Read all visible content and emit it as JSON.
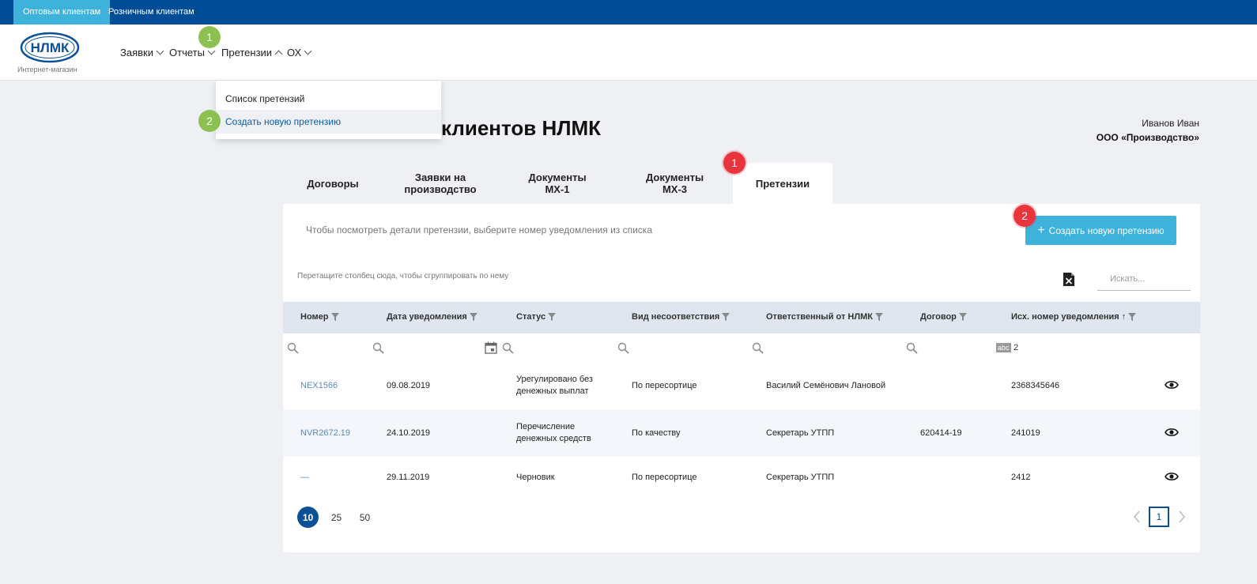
{
  "topbar": {
    "wholesale": "Оптовым клиентам",
    "retail": "Розничным клиентам"
  },
  "header": {
    "logo_text": "НЛМК",
    "logo_subtitle": "Интернет-магазин",
    "nav": {
      "orders": "Заявки",
      "reports": "Отчеты",
      "claims": "Претензии",
      "ox": "ОХ"
    }
  },
  "dropdown": {
    "list": "Список претензий",
    "create": "Создать новую претензию"
  },
  "badges": {
    "n1": "1",
    "n2": "2"
  },
  "page": {
    "title": "клиентов НЛМК",
    "user_name": "Иванов Иван",
    "user_org": "ООО «Производство»"
  },
  "tabs": {
    "contracts": "Договоры",
    "orders_line1": "Заявки на",
    "orders_line2": "производство",
    "mx1_line1": "Документы",
    "mx1_line2": "МХ-1",
    "mx3_line1": "Документы",
    "mx3_line2": "МХ-3",
    "claims": "Претензии"
  },
  "panel": {
    "hint": "Чтобы посмотреть детали претензии, выберите номер уведомления из списка",
    "create_button": "Создать новую претензию",
    "group_hint": "Перетащите столбец сюда, чтобы сгруппировать по нему",
    "search_placeholder": "Искать..."
  },
  "table": {
    "headers": {
      "number": "Номер",
      "date": "Дата уведомления",
      "status": "Статус",
      "type": "Вид несоответствия",
      "responsible": "Ответственный от НЛМК",
      "contract": "Договор",
      "outgoing": "Исх. номер уведомления",
      "sort_indicator": "↑"
    },
    "filter_value": "2",
    "rows": [
      {
        "number": "NEX1566",
        "date": "09.08.2019",
        "status_l1": "Урегулировано без",
        "status_l2": "денежных выплат",
        "type": "По пересортице",
        "responsible": "Василий Семёнович Лановой",
        "contract": "",
        "outgoing": "2368345646"
      },
      {
        "number": "NVR2672.19",
        "date": "24.10.2019",
        "status_l1": "Перечисление",
        "status_l2": "денежных средств",
        "type": "По качеству",
        "responsible": "Секретарь УТПП",
        "contract": "620414-19",
        "outgoing": "241019"
      },
      {
        "number": "—",
        "date": "29.11.2019",
        "status_l1": "Черновик",
        "status_l2": "",
        "type": "По пересортице",
        "responsible": "Секретарь УТПП",
        "contract": "",
        "outgoing": "2412"
      }
    ]
  },
  "pager": {
    "size_10": "10",
    "size_25": "25",
    "size_50": "50",
    "current_page": "1"
  },
  "colors": {
    "brand": "#004c97",
    "accent": "#3fb2dc",
    "badge_green": "#8cc152",
    "badge_red": "#e8343a"
  }
}
